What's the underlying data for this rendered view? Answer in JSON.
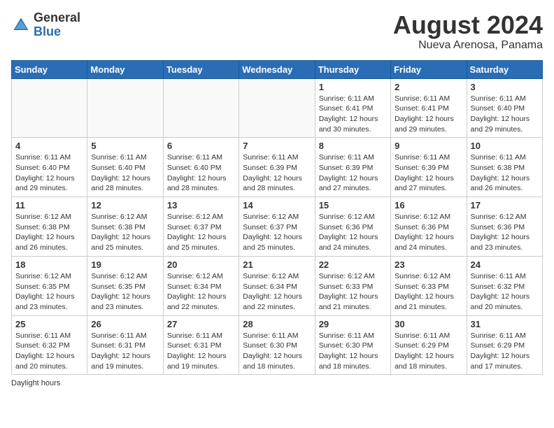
{
  "header": {
    "logo_general": "General",
    "logo_blue": "Blue",
    "month_year": "August 2024",
    "location": "Nueva Arenosa, Panama"
  },
  "days_of_week": [
    "Sunday",
    "Monday",
    "Tuesday",
    "Wednesday",
    "Thursday",
    "Friday",
    "Saturday"
  ],
  "weeks": [
    {
      "days": [
        {
          "num": "",
          "info": ""
        },
        {
          "num": "",
          "info": ""
        },
        {
          "num": "",
          "info": ""
        },
        {
          "num": "",
          "info": ""
        },
        {
          "num": "1",
          "info": "Sunrise: 6:11 AM\nSunset: 6:41 PM\nDaylight: 12 hours and 30 minutes."
        },
        {
          "num": "2",
          "info": "Sunrise: 6:11 AM\nSunset: 6:41 PM\nDaylight: 12 hours and 29 minutes."
        },
        {
          "num": "3",
          "info": "Sunrise: 6:11 AM\nSunset: 6:40 PM\nDaylight: 12 hours and 29 minutes."
        }
      ]
    },
    {
      "days": [
        {
          "num": "4",
          "info": "Sunrise: 6:11 AM\nSunset: 6:40 PM\nDaylight: 12 hours and 29 minutes."
        },
        {
          "num": "5",
          "info": "Sunrise: 6:11 AM\nSunset: 6:40 PM\nDaylight: 12 hours and 28 minutes."
        },
        {
          "num": "6",
          "info": "Sunrise: 6:11 AM\nSunset: 6:40 PM\nDaylight: 12 hours and 28 minutes."
        },
        {
          "num": "7",
          "info": "Sunrise: 6:11 AM\nSunset: 6:39 PM\nDaylight: 12 hours and 28 minutes."
        },
        {
          "num": "8",
          "info": "Sunrise: 6:11 AM\nSunset: 6:39 PM\nDaylight: 12 hours and 27 minutes."
        },
        {
          "num": "9",
          "info": "Sunrise: 6:11 AM\nSunset: 6:39 PM\nDaylight: 12 hours and 27 minutes."
        },
        {
          "num": "10",
          "info": "Sunrise: 6:11 AM\nSunset: 6:38 PM\nDaylight: 12 hours and 26 minutes."
        }
      ]
    },
    {
      "days": [
        {
          "num": "11",
          "info": "Sunrise: 6:12 AM\nSunset: 6:38 PM\nDaylight: 12 hours and 26 minutes."
        },
        {
          "num": "12",
          "info": "Sunrise: 6:12 AM\nSunset: 6:38 PM\nDaylight: 12 hours and 25 minutes."
        },
        {
          "num": "13",
          "info": "Sunrise: 6:12 AM\nSunset: 6:37 PM\nDaylight: 12 hours and 25 minutes."
        },
        {
          "num": "14",
          "info": "Sunrise: 6:12 AM\nSunset: 6:37 PM\nDaylight: 12 hours and 25 minutes."
        },
        {
          "num": "15",
          "info": "Sunrise: 6:12 AM\nSunset: 6:36 PM\nDaylight: 12 hours and 24 minutes."
        },
        {
          "num": "16",
          "info": "Sunrise: 6:12 AM\nSunset: 6:36 PM\nDaylight: 12 hours and 24 minutes."
        },
        {
          "num": "17",
          "info": "Sunrise: 6:12 AM\nSunset: 6:36 PM\nDaylight: 12 hours and 23 minutes."
        }
      ]
    },
    {
      "days": [
        {
          "num": "18",
          "info": "Sunrise: 6:12 AM\nSunset: 6:35 PM\nDaylight: 12 hours and 23 minutes."
        },
        {
          "num": "19",
          "info": "Sunrise: 6:12 AM\nSunset: 6:35 PM\nDaylight: 12 hours and 23 minutes."
        },
        {
          "num": "20",
          "info": "Sunrise: 6:12 AM\nSunset: 6:34 PM\nDaylight: 12 hours and 22 minutes."
        },
        {
          "num": "21",
          "info": "Sunrise: 6:12 AM\nSunset: 6:34 PM\nDaylight: 12 hours and 22 minutes."
        },
        {
          "num": "22",
          "info": "Sunrise: 6:12 AM\nSunset: 6:33 PM\nDaylight: 12 hours and 21 minutes."
        },
        {
          "num": "23",
          "info": "Sunrise: 6:12 AM\nSunset: 6:33 PM\nDaylight: 12 hours and 21 minutes."
        },
        {
          "num": "24",
          "info": "Sunrise: 6:11 AM\nSunset: 6:32 PM\nDaylight: 12 hours and 20 minutes."
        }
      ]
    },
    {
      "days": [
        {
          "num": "25",
          "info": "Sunrise: 6:11 AM\nSunset: 6:32 PM\nDaylight: 12 hours and 20 minutes."
        },
        {
          "num": "26",
          "info": "Sunrise: 6:11 AM\nSunset: 6:31 PM\nDaylight: 12 hours and 19 minutes."
        },
        {
          "num": "27",
          "info": "Sunrise: 6:11 AM\nSunset: 6:31 PM\nDaylight: 12 hours and 19 minutes."
        },
        {
          "num": "28",
          "info": "Sunrise: 6:11 AM\nSunset: 6:30 PM\nDaylight: 12 hours and 18 minutes."
        },
        {
          "num": "29",
          "info": "Sunrise: 6:11 AM\nSunset: 6:30 PM\nDaylight: 12 hours and 18 minutes."
        },
        {
          "num": "30",
          "info": "Sunrise: 6:11 AM\nSunset: 6:29 PM\nDaylight: 12 hours and 18 minutes."
        },
        {
          "num": "31",
          "info": "Sunrise: 6:11 AM\nSunset: 6:29 PM\nDaylight: 12 hours and 17 minutes."
        }
      ]
    }
  ],
  "footer": {
    "text": "Daylight hours",
    "url": "https://www.generalblue.com"
  }
}
